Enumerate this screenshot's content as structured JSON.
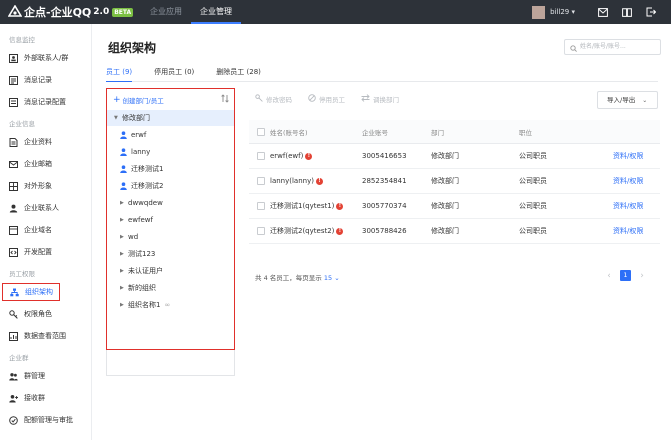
{
  "app": {
    "title": "企点-企业QQ",
    "version": "2.0",
    "badge": "BETA"
  },
  "topnav": [
    {
      "label": "企业应用"
    },
    {
      "label": "企业管理"
    }
  ],
  "user": {
    "name": "bill29"
  },
  "sidebar": {
    "groups": [
      {
        "title": "信息监控",
        "items": [
          {
            "label": "外部联系人/群"
          },
          {
            "label": "消息记录"
          },
          {
            "label": "消息记录配置"
          }
        ]
      },
      {
        "title": "企业信息",
        "items": [
          {
            "label": "企业资料"
          },
          {
            "label": "企业邮箱"
          },
          {
            "label": "对外形象"
          },
          {
            "label": "企业联系人"
          },
          {
            "label": "企业域名"
          },
          {
            "label": "开发配置"
          }
        ]
      },
      {
        "title": "员工权限",
        "items": [
          {
            "label": "组织架构"
          },
          {
            "label": "权限角色"
          },
          {
            "label": "数据查看范围"
          }
        ]
      },
      {
        "title": "企业群",
        "items": [
          {
            "label": "群管理"
          },
          {
            "label": "接收群"
          },
          {
            "label": "配额管理与审批"
          }
        ]
      }
    ]
  },
  "page": {
    "title": "组织架构",
    "search_placeholder": "姓名/账号/账号..."
  },
  "tabs": [
    {
      "label": "员工 (9)"
    },
    {
      "label": "停用员工 (0)"
    },
    {
      "label": "删除员工 (28)"
    }
  ],
  "dept_panel": {
    "create_label": "创建部门/员工",
    "root": "修改部门",
    "users": [
      "erwf",
      "lanny",
      "迁移测试1",
      "迁移测试2"
    ],
    "departments": [
      "dwwqdew",
      "ewfewf",
      "wd",
      "测试123",
      "未认证用户",
      "新的组织",
      "组织名称1"
    ]
  },
  "toolbar": {
    "actions": [
      "修改密码",
      "停用员工",
      "调换部门"
    ],
    "import_export": "导入/导出"
  },
  "table": {
    "headers": [
      "姓名(账号名)",
      "企业账号",
      "部门",
      "职位"
    ],
    "rows": [
      {
        "name": "erwf(ewf)",
        "account": "3005416653",
        "dept": "修改部门",
        "position": "公司职员",
        "action": "资料/权限"
      },
      {
        "name": "lanny(lanny)",
        "account": "2852354841",
        "dept": "修改部门",
        "position": "公司职员",
        "action": "资料/权限"
      },
      {
        "name": "迁移测试1(qytest1)",
        "account": "3005770374",
        "dept": "修改部门",
        "position": "公司职员",
        "action": "资料/权限"
      },
      {
        "name": "迁移测试2(qytest2)",
        "account": "3005788426",
        "dept": "修改部门",
        "position": "公司职员",
        "action": "资料/权限"
      }
    ],
    "footer_text": "共 4 名员工，每页显示",
    "page_size": "15",
    "current_page": "1"
  },
  "colors": {
    "accent": "#2d6ff7",
    "highlight": "#e0302b",
    "topbar": "#2d3239"
  }
}
